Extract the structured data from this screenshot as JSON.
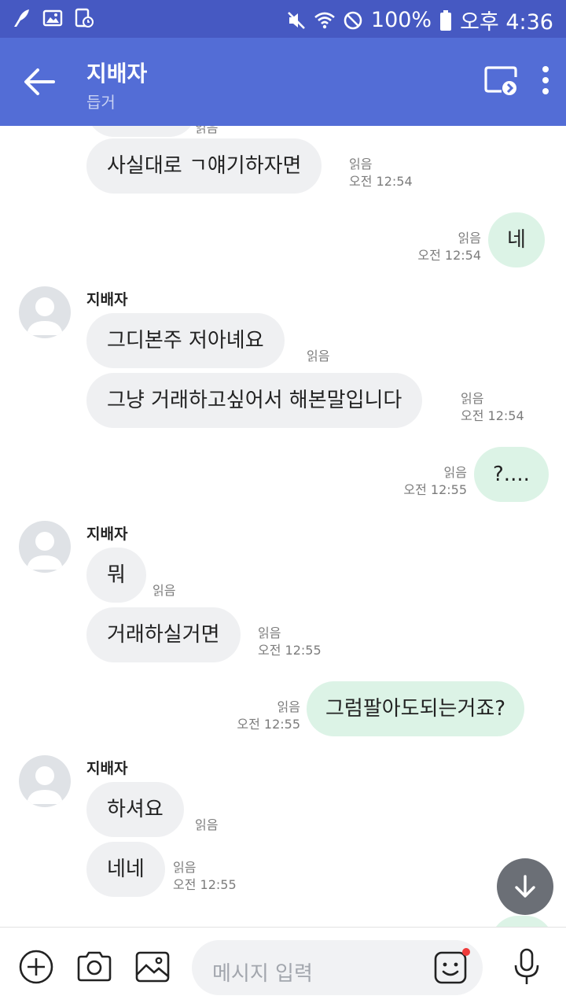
{
  "status_bar": {
    "battery": "100%",
    "time": "오후 4:36"
  },
  "header": {
    "title": "지배자",
    "subtitle": "듭거"
  },
  "messages": [
    {
      "from": "them",
      "text": "사실대로 ㄱ얘기하자면",
      "read": "읽음",
      "time": "오전 12:54"
    },
    {
      "from": "me",
      "text": "네",
      "read": "읽음",
      "time": "오전 12:54"
    },
    {
      "from": "them",
      "sender": "지배자",
      "text": "그디본주 저아녜요",
      "read": "읽음",
      "time": ""
    },
    {
      "from": "them",
      "text": "그냥 거래하고싶어서 해본말입니다",
      "read": "읽음",
      "time": "오전 12:54"
    },
    {
      "from": "me",
      "text": "?....",
      "read": "읽음",
      "time": "오전 12:55"
    },
    {
      "from": "them",
      "sender": "지배자",
      "text": "뭐",
      "read": "읽음",
      "time": ""
    },
    {
      "from": "them",
      "text": "거래하실거면",
      "read": "읽음",
      "time": "오전 12:55"
    },
    {
      "from": "me",
      "text": "그럼팔아도되는거죠?",
      "read": "읽음",
      "time": "오전 12:55"
    },
    {
      "from": "them",
      "sender": "지배자",
      "text": "하셔요",
      "read": "읽음",
      "time": ""
    },
    {
      "from": "them",
      "text": "네네",
      "read": "읽음",
      "time": "오전 12:55"
    }
  ],
  "top_partial": {
    "read": "읽음"
  },
  "input": {
    "placeholder": "메시지 입력"
  },
  "colors": {
    "status_bar": "#4659c2",
    "header": "#536dd6",
    "incoming_bubble": "#eff0f2",
    "outgoing_bubble": "#dcf3e6",
    "notification_dot": "#ef3b3b"
  },
  "icons": {
    "back": "arrow-left-icon",
    "cast": "screen-share-icon",
    "more": "more-vertical-icon",
    "add": "plus-circle-icon",
    "camera": "camera-icon",
    "gallery": "image-icon",
    "emoji": "emoji-icon",
    "mic": "microphone-icon",
    "scroll_down": "arrow-down-icon"
  }
}
